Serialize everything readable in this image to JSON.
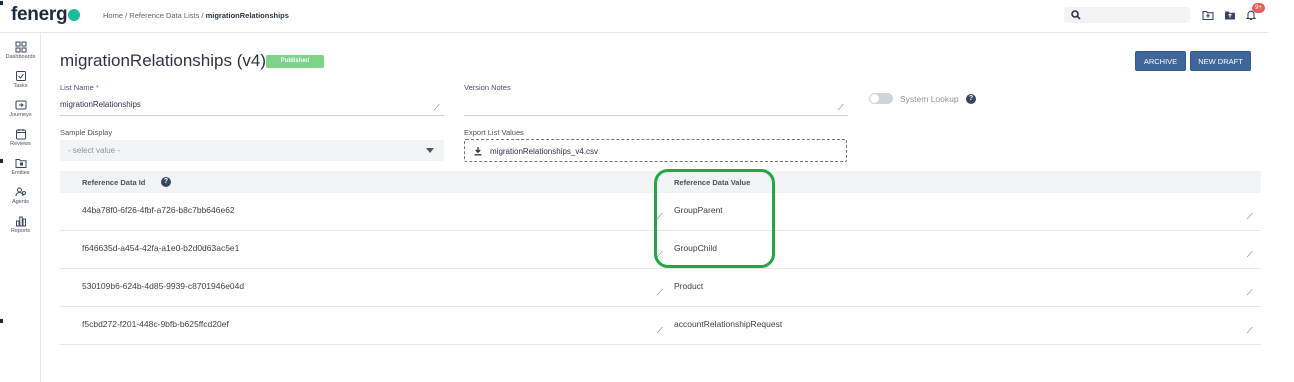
{
  "brand": {
    "logo_text": "fenerg",
    "accent": "#1abc9c"
  },
  "breadcrumb": {
    "home": "Home",
    "sep1": " / ",
    "list": "Reference Data Lists",
    "sep2": " / ",
    "current": "migrationRelationships"
  },
  "topbar": {
    "search_placeholder": "",
    "notification_count": "9+"
  },
  "sidebar": {
    "items": [
      {
        "label": "Dashboards",
        "icon": "dashboard-icon"
      },
      {
        "label": "Tasks",
        "icon": "tasks-icon"
      },
      {
        "label": "Journeys",
        "icon": "journeys-icon"
      },
      {
        "label": "Reviews",
        "icon": "reviews-icon"
      },
      {
        "label": "Entities",
        "icon": "entities-icon"
      },
      {
        "label": "Agents",
        "icon": "agents-icon"
      },
      {
        "label": "Reports",
        "icon": "reports-icon"
      }
    ]
  },
  "header": {
    "title": "migrationRelationships (v4)",
    "status": "Published",
    "archive_label": "ARCHIVE",
    "new_draft_label": "NEW DRAFT"
  },
  "form": {
    "list_name_label": "List Name",
    "required_mark": "*",
    "list_name_value": "migrationRelationships",
    "version_notes_label": "Version Notes",
    "version_notes_value": "",
    "system_lookup_label": "System Lookup",
    "system_lookup_on": false,
    "sample_display_label": "Sample Display",
    "sample_display_placeholder": "- select value -",
    "export_label": "Export List Values",
    "export_file": "migrationRelationships_v4.csv"
  },
  "table": {
    "columns": [
      "Reference Data Id",
      "Reference Data Value"
    ],
    "rows": [
      {
        "id": "44ba78f0-6f26-4fbf-a726-b8c7bb646e62",
        "value": "GroupParent"
      },
      {
        "id": "f646635d-a454-42fa-a1e0-b2d0d63ac5e1",
        "value": "GroupChild"
      },
      {
        "id": "530109b6-624b-4d85-9939-c8701946e04d",
        "value": "Product"
      },
      {
        "id": "f5cbd272-f201-448c-9bfb-b625ffcd20ef",
        "value": "accountRelationshipRequest"
      }
    ]
  },
  "colors": {
    "primary_button": "#3f6699",
    "published_badge": "#7cd48a",
    "highlight": "#1fa845",
    "notification": "#e85d5d"
  }
}
